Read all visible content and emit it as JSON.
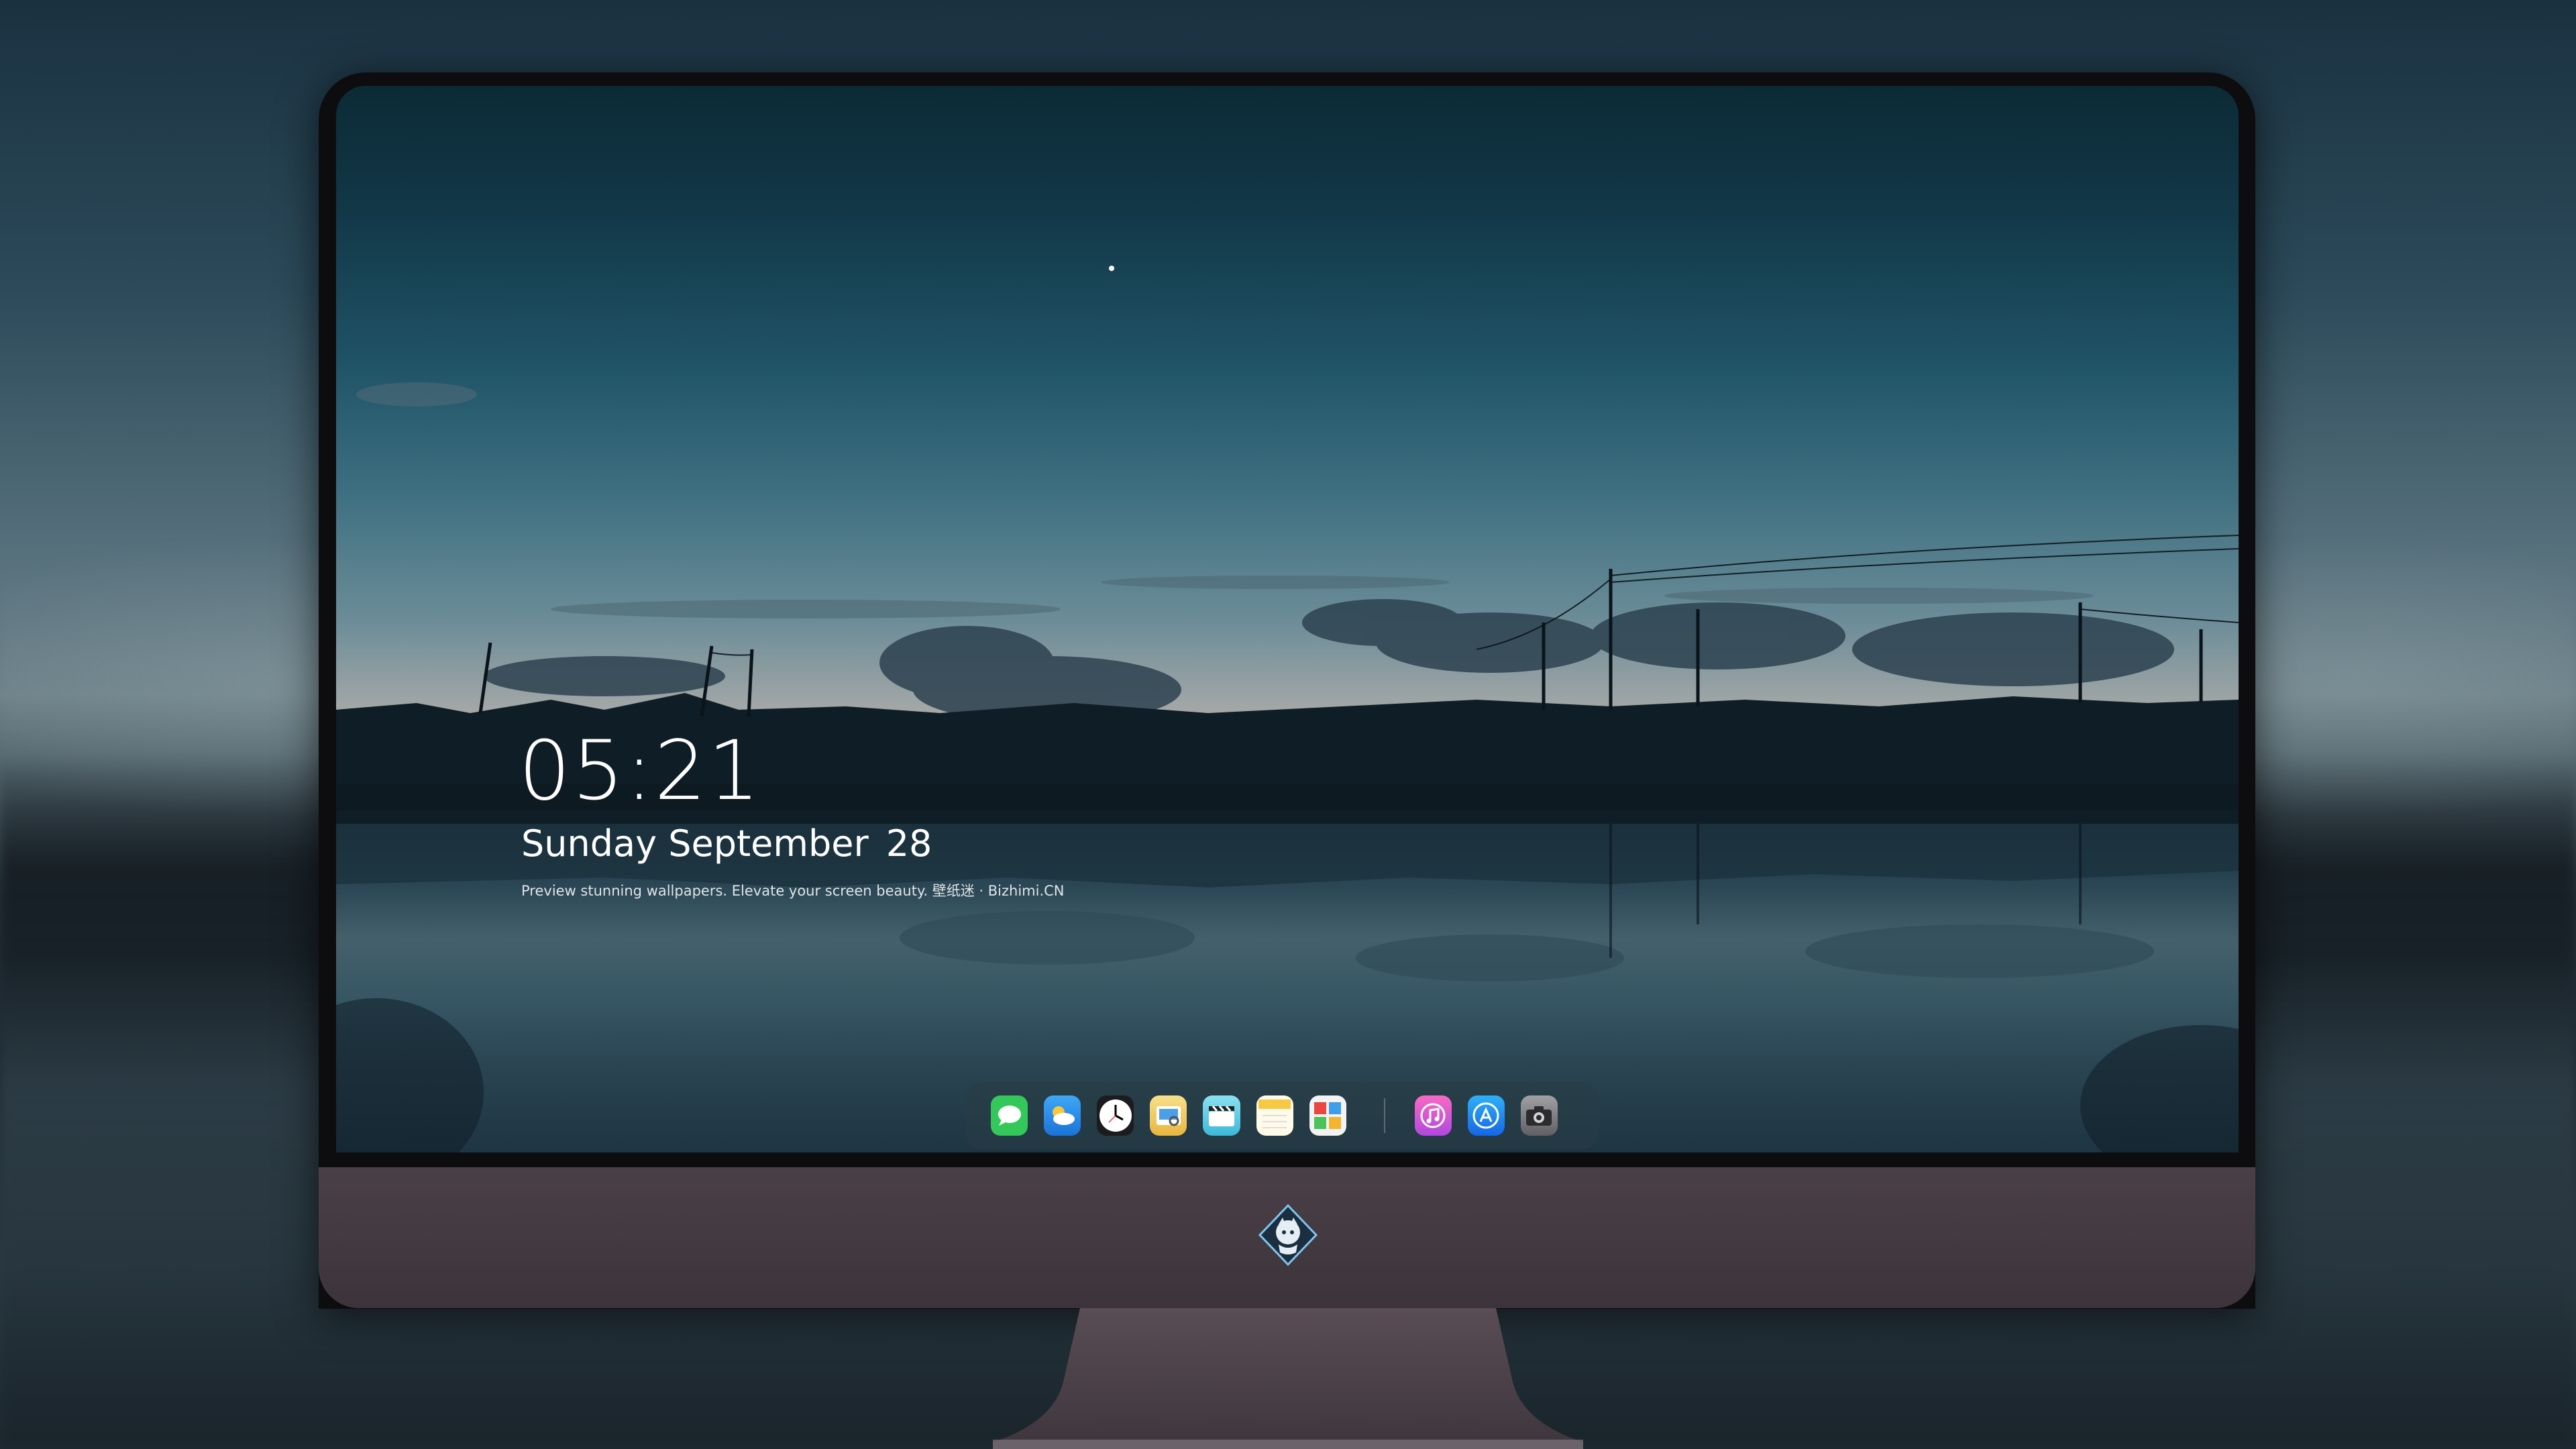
{
  "lockscreen": {
    "time": "05:21",
    "date_weekday_month": "Sunday September",
    "date_day": "28",
    "tagline": "Preview stunning wallpapers. Elevate your screen beauty. 壁纸迷 · Bizhimi.CN"
  },
  "dock": {
    "apps": [
      {
        "icon": "messages-icon",
        "color": "#34c759"
      },
      {
        "icon": "weather-icon",
        "color": "#2f9cf0"
      },
      {
        "icon": "clock-icon",
        "color": "#ffffff"
      },
      {
        "icon": "preview-icon",
        "color": "#f2c744"
      },
      {
        "icon": "clips-icon",
        "color": "#6fd2e8"
      },
      {
        "icon": "notes-icon",
        "color": "#f7d154"
      },
      {
        "icon": "photo-booth-icon",
        "color": "#e9473f"
      },
      {
        "icon": "itunes-icon",
        "color": "#d34fd7"
      },
      {
        "icon": "app-store-icon",
        "color": "#1e8cf2"
      },
      {
        "icon": "camera-icon",
        "color": "#8e8e93"
      }
    ]
  }
}
